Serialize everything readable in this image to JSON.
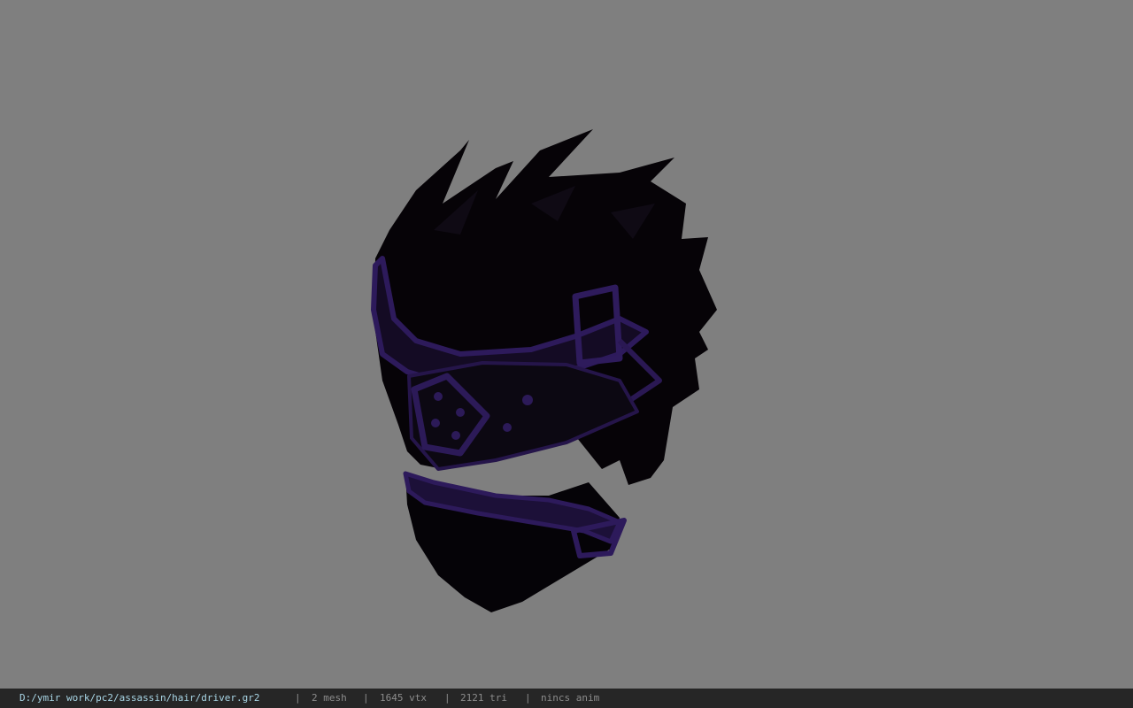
{
  "status_bar": {
    "file_path": "D:/ymir work/pc2/assassin/hair/driver.gr2",
    "separator": "|",
    "mesh_count": "2 mesh",
    "vertex_count": "1645 vtx",
    "triangle_count": "2121 tri",
    "anim_status": "nincs anim"
  },
  "colors": {
    "background": "#7f7f7f",
    "model_base": "#070309",
    "model_accent": "#2e1b5c",
    "status_bg": "#262626",
    "path_text": "#a9d6e6"
  },
  "viewport": {
    "model_icon": "hair-mesh-3d"
  }
}
